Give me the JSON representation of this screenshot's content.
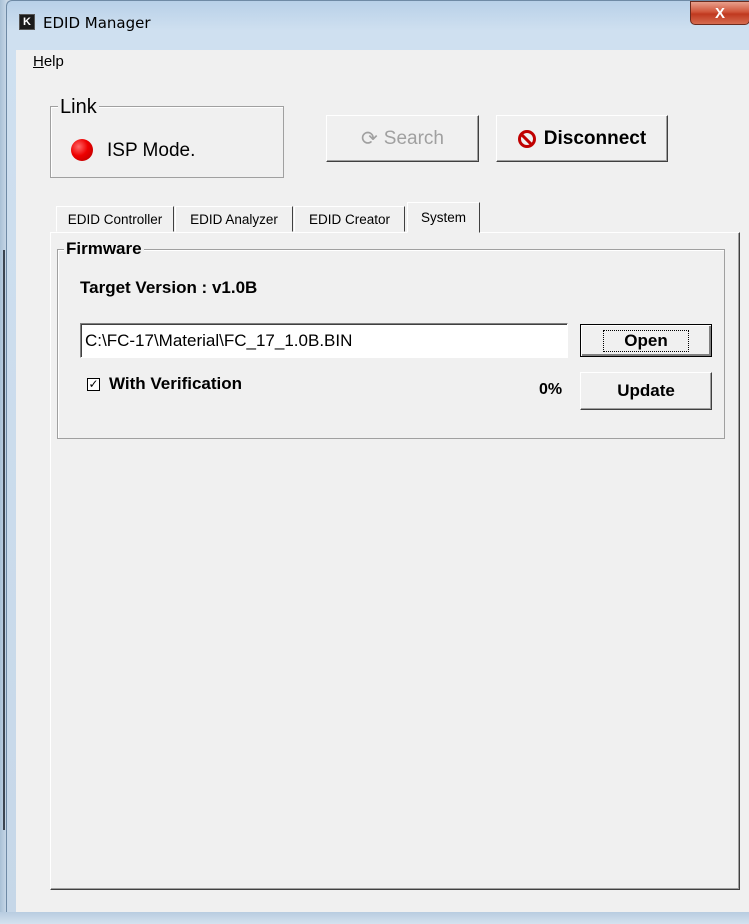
{
  "window": {
    "title": "EDID Manager",
    "close_label": "X",
    "app_icon_glyph": "K"
  },
  "menu": {
    "help_prefix": "H",
    "help_rest": "elp"
  },
  "link": {
    "legend": "Link",
    "status": "ISP Mode.",
    "status_color": "#ee0000"
  },
  "buttons": {
    "search": "Search",
    "disconnect": "Disconnect"
  },
  "tabs": [
    {
      "label": "EDID Controller"
    },
    {
      "label": "EDID Analyzer"
    },
    {
      "label": "EDID Creator"
    },
    {
      "label": "System",
      "active": true
    }
  ],
  "firmware": {
    "legend": "Firmware",
    "target_version": "Target Version : v1.0B",
    "file_path": "C:\\FC-17\\Material\\FC_17_1.0B.BIN",
    "open_label": "Open",
    "with_verification_label": "With Verification",
    "with_verification_checked": true,
    "progress": "0%",
    "update_label": "Update"
  }
}
